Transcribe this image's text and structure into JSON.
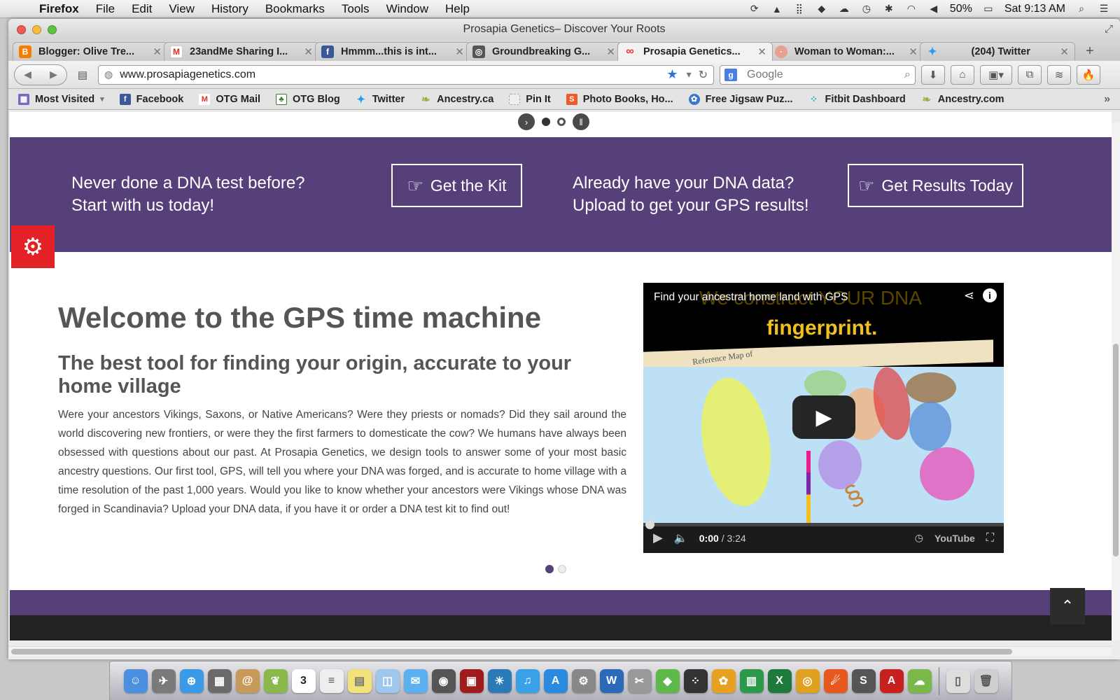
{
  "menubar": {
    "app_name": "Firefox",
    "menus": [
      "File",
      "Edit",
      "View",
      "History",
      "Bookmarks",
      "Tools",
      "Window",
      "Help"
    ],
    "battery": "50%",
    "clock": "Sat 9:13 AM"
  },
  "window": {
    "title": "Prosapia Genetics– Discover Your Roots"
  },
  "tabs": [
    {
      "label": "Blogger: Olive Tre...",
      "icon": "blogger-icon",
      "color": "#f57d00"
    },
    {
      "label": "23andMe Sharing I...",
      "icon": "gmail-icon",
      "color": "#d93025"
    },
    {
      "label": "Hmmm...this is int...",
      "icon": "facebook-icon",
      "color": "#3b5998"
    },
    {
      "label": "Groundbreaking G...",
      "icon": "site-icon",
      "color": "#555555"
    },
    {
      "label": "Prosapia Genetics...",
      "icon": "infinity-icon",
      "color": "#e33",
      "active": true
    },
    {
      "label": "Woman to Woman:...",
      "icon": "site-icon",
      "color": "#e8a090"
    },
    {
      "label": "(204) Twitter",
      "icon": "twitter-icon",
      "color": "#1da1f2"
    }
  ],
  "navbar": {
    "url": "www.prosapiagenetics.com",
    "search_placeholder": "Google"
  },
  "bookmarks": [
    {
      "label": "Most Visited",
      "color": "#7a6abf"
    },
    {
      "label": "Facebook",
      "color": "#3b5998"
    },
    {
      "label": "OTG Mail",
      "color": "#d93025"
    },
    {
      "label": "OTG Blog",
      "color": "#3a7a2a"
    },
    {
      "label": "Twitter",
      "color": "#1da1f2"
    },
    {
      "label": "Ancestry.ca",
      "color": "#9fb13c"
    },
    {
      "label": "Pin It",
      "color": "#dddddd"
    },
    {
      "label": "Photo Books, Ho...",
      "color": "#f05a28"
    },
    {
      "label": "Free Jigsaw Puz...",
      "color": "#3a78c8"
    },
    {
      "label": "Fitbit Dashboard",
      "color": "#00b0b9"
    },
    {
      "label": "Ancestry.com",
      "color": "#9fb13c"
    }
  ],
  "cta": {
    "left_text_line1": "Never done a DNA test before?",
    "left_text_line2": "Start with us today!",
    "left_button": "Get the Kit",
    "right_text_line1": "Already have your DNA data?",
    "right_text_line2": "Upload to get your GPS results!",
    "right_button": "Get Results Today"
  },
  "content": {
    "title": "Welcome to the GPS time machine",
    "subtitle": "The best tool for finding your origin, accurate to your home village",
    "body": "Were your ancestors Vikings, Saxons, or Native Americans? Were they priests or nomads? Did they sail around the world discovering new frontiers, or were they the first farmers to domesticate the cow? We humans have always been obsessed with questions about our past. At Prosapia Genetics, we design tools to answer some of your most basic ancestry questions. Our first tool, GPS, will tell you where your DNA was forged, and is accurate to home village with a time resolution of the past 1,000 years. Would you like to know whether your ancestors were Vikings whose DNA was forged in Scandinavia? Upload your DNA data, if you have it or order a DNA test kit to find out!"
  },
  "video": {
    "title": "Find your ancestral home land with GPS",
    "ghost_text": "We construct YOUR DNA",
    "frame_text": "fingerprint.",
    "map_label": "Reference Map of",
    "time_current": "0:00",
    "time_total": "/ 3:24",
    "progress": 0,
    "brand": "YouTube"
  },
  "colors": {
    "brand_purple": "#56407a",
    "settings_red": "#e42127"
  }
}
